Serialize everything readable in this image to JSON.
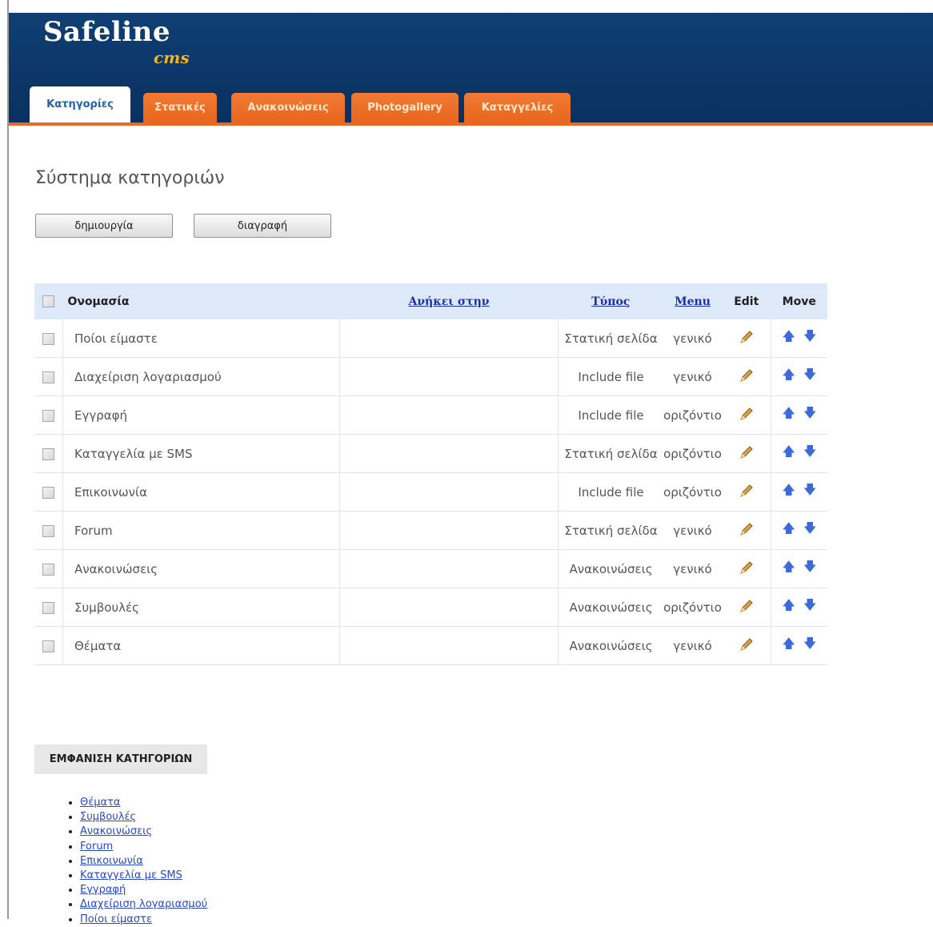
{
  "header": {
    "logo_main": "Safeline",
    "logo_sub": "cms",
    "tabs": [
      {
        "label": "Κατηγορίες",
        "active": true
      },
      {
        "label": "Στατικές",
        "active": false
      },
      {
        "label": "Ανακοινώσεις",
        "active": false
      },
      {
        "label": "Photogallery",
        "active": false
      },
      {
        "label": "Καταγγελίες",
        "active": false
      }
    ]
  },
  "main": {
    "title": "Σύστημα κατηγοριών",
    "create_button": "δημιουργία",
    "delete_button": "διαγραφή",
    "table": {
      "headers": {
        "name": "Ονομασία",
        "parent": "Ανήκει στην",
        "type": "Τύπος",
        "menu": "Menu",
        "edit": "Edit",
        "move": "Move"
      },
      "rows": [
        {
          "name": "Ποίοι είμαστε",
          "parent": "",
          "type": "Στατική σελίδα",
          "menu": "γενικό"
        },
        {
          "name": "Διαχείριση λογαριασμού",
          "parent": "",
          "type": "Include file",
          "menu": "γενικό"
        },
        {
          "name": "Εγγραφή",
          "parent": "",
          "type": "Include file",
          "menu": "οριζόντιο"
        },
        {
          "name": "Καταγγελία με SMS",
          "parent": "",
          "type": "Στατική σελίδα",
          "menu": "οριζόντιο"
        },
        {
          "name": "Επικοινωνία",
          "parent": "",
          "type": "Include file",
          "menu": "οριζόντιο"
        },
        {
          "name": "Forum",
          "parent": "",
          "type": "Στατική σελίδα",
          "menu": "γενικό"
        },
        {
          "name": "Ανακοινώσεις",
          "parent": "",
          "type": "Ανακοινώσεις",
          "menu": "γενικό"
        },
        {
          "name": "Συμβουλές",
          "parent": "",
          "type": "Ανακοινώσεις",
          "menu": "οριζόντιο"
        },
        {
          "name": "Θέματα",
          "parent": "",
          "type": "Ανακοινώσεις",
          "menu": "γενικό"
        }
      ]
    }
  },
  "display_section": {
    "label": "ΕΜΦΑΝΙΣΗ ΚΑΤΗΓΟΡΙΩΝ",
    "items": [
      "Θέματα",
      "Συμβουλές",
      "Ανακοινώσεις",
      "Forum",
      "Επικοινωνία",
      "Καταγγελία με SMS",
      "Εγγραφή",
      "Διαχείριση λογαριασμού",
      "Ποίοι είμαστε"
    ]
  },
  "icons": {
    "edit": "pencil-icon",
    "move_up": "arrow-up-icon",
    "move_down": "arrow-down-icon"
  },
  "colors": {
    "header_bg": "#0c3768",
    "tab_orange": "#e8661f",
    "active_tab_text": "#1d63ad",
    "table_header_bg": "#dde9f8",
    "link": "#1b2fa8"
  }
}
